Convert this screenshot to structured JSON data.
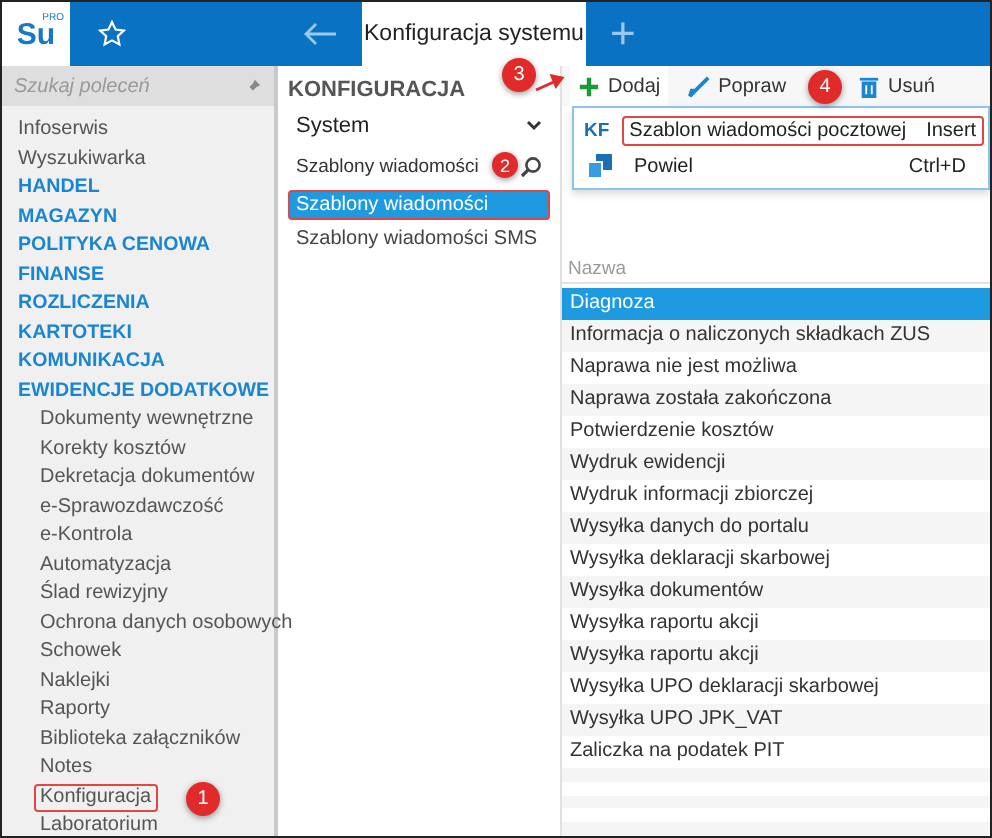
{
  "header": {
    "logo": "Su",
    "logo_badge": "PRO",
    "tab": "Konfiguracja systemu",
    "add_tab": "+"
  },
  "sidebar": {
    "search": {
      "placeholder": "Szukaj poleceń"
    },
    "items": [
      {
        "label": "Infoserwis",
        "kind": "link"
      },
      {
        "label": "Wyszukiwarka",
        "kind": "link"
      },
      {
        "label": "HANDEL",
        "kind": "section"
      },
      {
        "label": "MAGAZYN",
        "kind": "section"
      },
      {
        "label": "POLITYKA CENOWA",
        "kind": "section"
      },
      {
        "label": "FINANSE",
        "kind": "section"
      },
      {
        "label": "ROZLICZENIA",
        "kind": "section"
      },
      {
        "label": "KARTOTEKI",
        "kind": "section"
      },
      {
        "label": "KOMUNIKACJA",
        "kind": "section"
      },
      {
        "label": "EWIDENCJE DODATKOWE",
        "kind": "section",
        "children": [
          {
            "label": "Dokumenty wewnętrzne",
            "highlighted": false
          },
          {
            "label": "Korekty kosztów",
            "highlighted": false
          },
          {
            "label": "Dekretacja dokumentów",
            "highlighted": false
          },
          {
            "label": "e-Sprawozdawczość",
            "highlighted": false
          },
          {
            "label": "e-Kontrola",
            "highlighted": false
          },
          {
            "label": "Automatyzacja",
            "highlighted": false
          },
          {
            "label": "Ślad rewizyjny",
            "highlighted": false
          },
          {
            "label": "Ochrona danych osobowych",
            "highlighted": false
          },
          {
            "label": "Schowek",
            "highlighted": false
          },
          {
            "label": "Naklejki",
            "highlighted": false
          },
          {
            "label": "Raporty",
            "highlighted": false
          },
          {
            "label": "Biblioteka załączników",
            "highlighted": false
          },
          {
            "label": "Notes",
            "highlighted": false
          },
          {
            "label": "Konfiguracja",
            "highlighted": true,
            "callout": "1"
          },
          {
            "label": "Laboratorium",
            "highlighted": false
          }
        ]
      }
    ]
  },
  "panel": {
    "title": "KONFIGURACJA",
    "select": "System",
    "search": {
      "value": "Szablony wiadomości",
      "callout": "2"
    },
    "items": [
      {
        "label": "Szablony wiadomości",
        "selected": true,
        "highlighted": true
      },
      {
        "label": "Szablony wiadomości SMS",
        "selected": false,
        "highlighted": false
      }
    ]
  },
  "toolbar": {
    "buttons": [
      {
        "label": "Dodaj",
        "kind": "add",
        "callout": "3"
      },
      {
        "label": "Popraw",
        "kind": "edit",
        "callout": "4"
      },
      {
        "label": "Usuń",
        "kind": "delete"
      }
    ]
  },
  "menu": {
    "items": [
      {
        "kind": "template",
        "badge": "KF",
        "label": "Szablon wiadomości pocztowej",
        "shortcut": "Insert",
        "highlighted": true
      },
      {
        "kind": "duplicate",
        "label": "Powiel",
        "shortcut": "Ctrl+D",
        "highlighted": false
      }
    ]
  },
  "table": {
    "columns": [
      "Nazwa"
    ],
    "rows": [
      {
        "name": "Diagnoza",
        "selected": true
      },
      {
        "name": "Informacja o naliczonych składkach ZUS",
        "selected": false
      },
      {
        "name": "Naprawa nie jest możliwa",
        "selected": false
      },
      {
        "name": "Naprawa została zakończona",
        "selected": false
      },
      {
        "name": "Potwierdzenie kosztów",
        "selected": false
      },
      {
        "name": "Wydruk ewidencji",
        "selected": false
      },
      {
        "name": "Wydruk informacji zbiorczej",
        "selected": false
      },
      {
        "name": "Wysyłka danych do portalu",
        "selected": false
      },
      {
        "name": "Wysyłka deklaracji skarbowej",
        "selected": false
      },
      {
        "name": "Wysyłka dokumentów",
        "selected": false
      },
      {
        "name": "Wysyłka raportu akcji",
        "selected": false
      },
      {
        "name": "Wysyłka raportu akcji",
        "selected": false
      },
      {
        "name": "Wysyłka UPO deklaracji skarbowej",
        "selected": false
      },
      {
        "name": "Wysyłka UPO JPK_VAT",
        "selected": false
      },
      {
        "name": "Zaliczka na podatek PIT",
        "selected": false
      }
    ]
  }
}
